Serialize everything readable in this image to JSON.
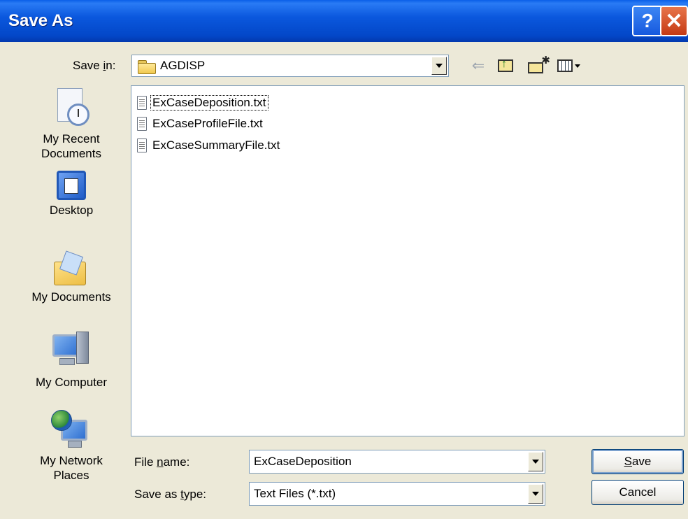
{
  "window": {
    "title": "Save As",
    "help_glyph": "?",
    "close_glyph": "✕"
  },
  "save_in": {
    "label": "Save in:",
    "current_folder": "AGDISP"
  },
  "toolbar": {
    "back_icon": "back-arrow-icon",
    "up_icon": "up-one-level-icon",
    "new_folder_icon": "new-folder-icon",
    "view_menu_icon": "view-menu-icon"
  },
  "places": [
    {
      "label": "My Recent Documents",
      "line1": "My Recent",
      "line2": "Documents"
    },
    {
      "label": "Desktop",
      "line1": "Desktop",
      "line2": ""
    },
    {
      "label": "My Documents",
      "line1": "My Documents",
      "line2": ""
    },
    {
      "label": "My Computer",
      "line1": "My Computer",
      "line2": ""
    },
    {
      "label": "My Network Places",
      "line1": "My Network",
      "line2": "Places"
    }
  ],
  "files": [
    {
      "name": "ExCaseDeposition.txt",
      "selected": true
    },
    {
      "name": "ExCaseProfileFile.txt",
      "selected": false
    },
    {
      "name": "ExCaseSummaryFile.txt",
      "selected": false
    }
  ],
  "file_name": {
    "label_pre": "File ",
    "label_underlined": "n",
    "label_post": "ame:",
    "value": "ExCaseDeposition"
  },
  "save_as_type": {
    "label_pre": "Save as ",
    "label_underlined": "t",
    "label_post": "ype:",
    "value": "Text Files (*.txt)"
  },
  "buttons": {
    "save_underlined": "S",
    "save_rest": "ave",
    "cancel": "Cancel"
  },
  "colors": {
    "titlebar": "#0B58DE",
    "dialog_bg": "#ECE9D8",
    "close_button": "#C53A14",
    "field_border": "#7F9DB9"
  }
}
